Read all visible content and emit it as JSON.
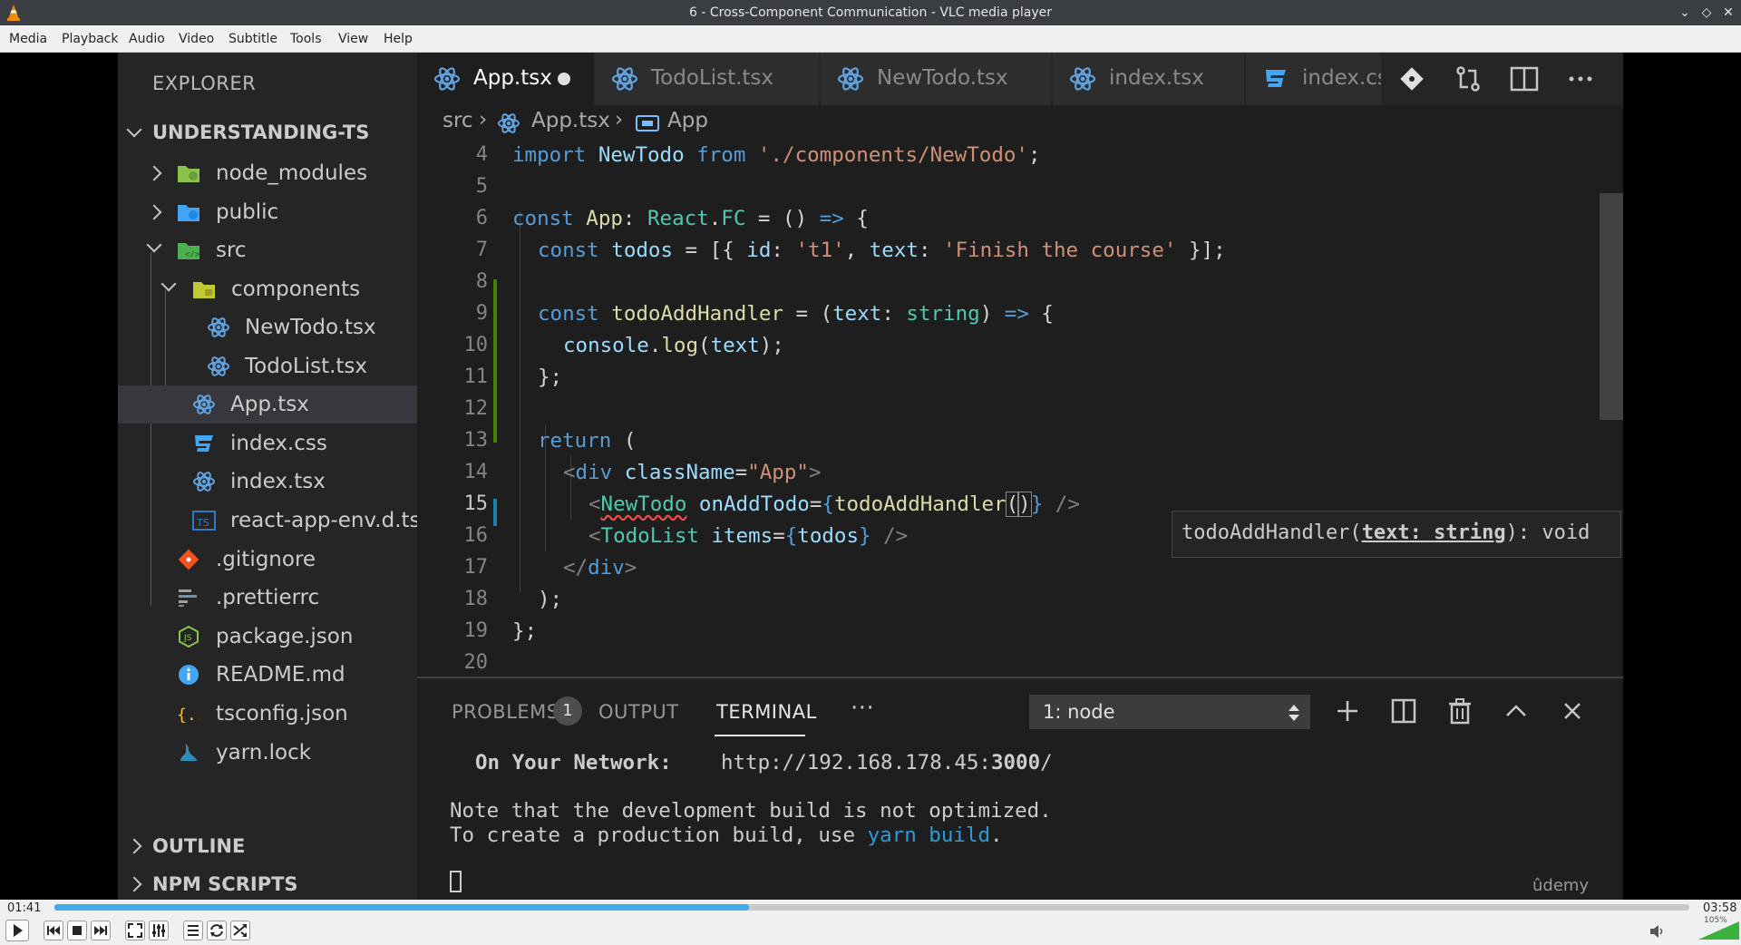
{
  "window": {
    "title": "6 - Cross-Component Communication - VLC media player"
  },
  "menu": [
    "Media",
    "Playback",
    "Audio",
    "Video",
    "Subtitle",
    "Tools",
    "View",
    "Help"
  ],
  "explorer": {
    "header": "EXPLORER",
    "project": "UNDERSTANDING-TS",
    "items": [
      {
        "name": "node_modules",
        "icon": "folder-node-icon"
      },
      {
        "name": "public",
        "icon": "folder-public-icon"
      },
      {
        "name": "src",
        "icon": "folder-src-icon"
      },
      {
        "name": "components",
        "icon": "folder-components-icon"
      },
      {
        "name": "NewTodo.tsx",
        "icon": "react-icon"
      },
      {
        "name": "TodoList.tsx",
        "icon": "react-icon"
      },
      {
        "name": "App.tsx",
        "icon": "react-icon"
      },
      {
        "name": "index.css",
        "icon": "css-icon"
      },
      {
        "name": "index.tsx",
        "icon": "react-icon"
      },
      {
        "name": "react-app-env.d.ts",
        "icon": "typescript-icon"
      },
      {
        "name": ".gitignore",
        "icon": "git-icon"
      },
      {
        "name": ".prettierrc",
        "icon": "prettier-icon"
      },
      {
        "name": "package.json",
        "icon": "nodejs-icon"
      },
      {
        "name": "README.md",
        "icon": "info-icon"
      },
      {
        "name": "tsconfig.json",
        "icon": "json-braces-icon"
      },
      {
        "name": "yarn.lock",
        "icon": "yarn-icon"
      }
    ],
    "outline": "OUTLINE",
    "npm_scripts": "NPM SCRIPTS"
  },
  "tabs": [
    {
      "label": "App.tsx"
    },
    {
      "label": "TodoList.tsx"
    },
    {
      "label": "NewTodo.tsx"
    },
    {
      "label": "index.tsx"
    },
    {
      "label": "index.cs"
    }
  ],
  "breadcrumb": {
    "folder": "src",
    "file": "App.tsx",
    "symbol": "App"
  },
  "line_numbers": [
    "4",
    "5",
    "6",
    "7",
    "8",
    "9",
    "10",
    "11",
    "12",
    "13",
    "14",
    "15",
    "16",
    "17",
    "18",
    "19",
    "20"
  ],
  "code": {
    "l4": {
      "a": "import",
      "b": " NewTodo ",
      "c": "from",
      "d": " './components/NewTodo'",
      "e": ";"
    },
    "l6": {
      "a": "const",
      "b": " App",
      "c": ": ",
      "d": "React",
      "e": ".",
      "f": "FC",
      "g": " = () ",
      "h": "=>",
      "i": " {"
    },
    "l7": {
      "a": "const",
      "b": " todos",
      "c": " = [{ ",
      "d": "id",
      "e": ": ",
      "f": "'t1'",
      "g": ", ",
      "h": "text",
      "i": ": ",
      "j": "'Finish the course'",
      "k": " }];"
    },
    "l9": {
      "a": "const",
      "b": " todoAddHandler",
      "c": " = (",
      "d": "text",
      "e": ": ",
      "f": "string",
      "g": ") ",
      "h": "=>",
      "i": " {"
    },
    "l10": {
      "a": "console",
      "b": ".",
      "c": "log",
      "d": "(",
      "e": "text",
      "f": ");"
    },
    "l11": {
      "a": "};"
    },
    "l13": {
      "a": "return",
      "b": " ("
    },
    "l14": {
      "a": "<",
      "b": "div",
      "c": " className",
      "d": "=",
      "e": "\"App\"",
      "f": ">"
    },
    "l15": {
      "a": "<",
      "b": "NewTodo",
      "c": " onAddTodo",
      "d": "=",
      "e": "{",
      "f": "todoAddHandler",
      "g": "(",
      "h": ")",
      "i": "}",
      "j": " />"
    },
    "l16": {
      "a": "<",
      "b": "TodoList",
      "c": " items",
      "d": "=",
      "e": "{",
      "f": "todos",
      "g": "}",
      "h": " />"
    },
    "l17": {
      "a": "</",
      "b": "div",
      "c": ">"
    },
    "l18": {
      "a": ");"
    },
    "l19": {
      "a": "};"
    }
  },
  "tooltip": {
    "fn": "todoAddHandler(",
    "param": "text: string",
    "rest": "): void"
  },
  "panel": {
    "problems": "PROBLEMS",
    "problems_count": "1",
    "output": "OUTPUT",
    "terminal": "TERMINAL",
    "more": "···",
    "terminal_select": "1: node",
    "lines": {
      "network_label": "On Your Network:",
      "network_url_a": "http://192.168.178.45:",
      "network_url_b": "3000",
      "network_url_c": "/",
      "note1": "Note that the development build is not optimized.",
      "note2a": "To create a production build, use ",
      "note2b": "yarn build",
      "note2c": "."
    },
    "watermark": "ûdemy"
  },
  "player": {
    "elapsed": "01:41",
    "total": "03:58",
    "progress_fraction": 0.425,
    "volume_label": "105%"
  }
}
